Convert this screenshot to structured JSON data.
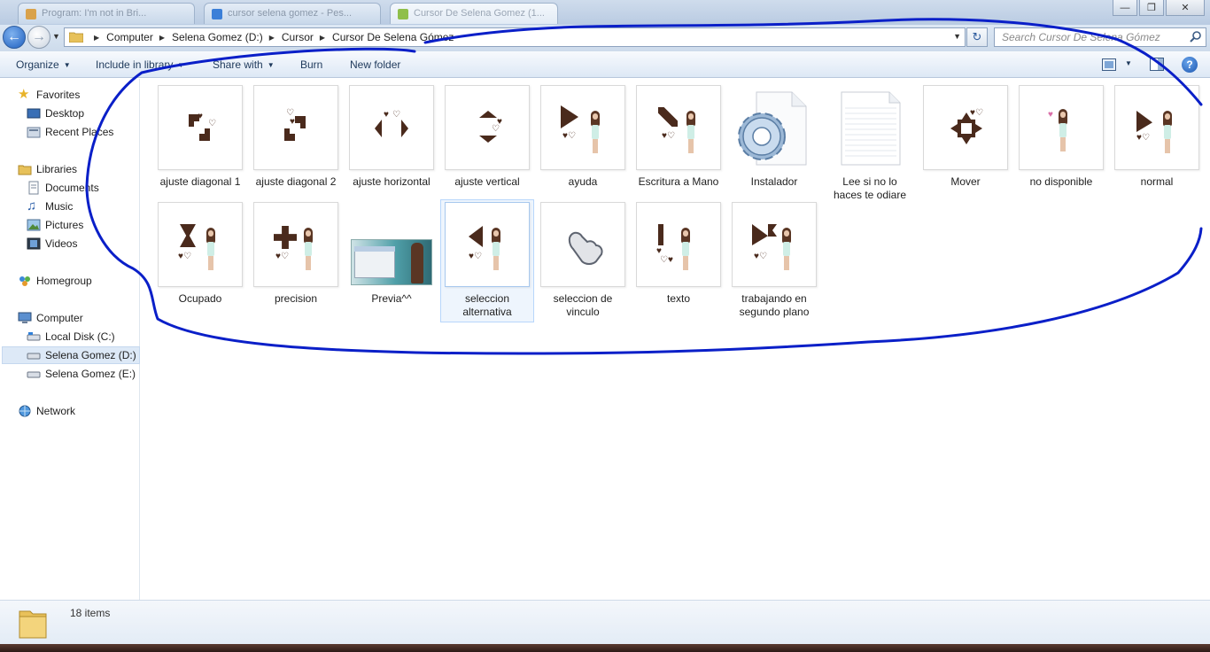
{
  "window": {
    "tabs": [
      {
        "label": "Program: I'm not in Bri..."
      },
      {
        "label": "cursor selena gomez - Pes..."
      },
      {
        "label": "Cursor De Selena Gomez (1..."
      }
    ],
    "controls": {
      "minimize": "—",
      "maximize": "❐",
      "close": "✕"
    }
  },
  "address_bar": {
    "crumbs": [
      "Computer",
      "Selena Gomez (D:)",
      "Cursor",
      "Cursor De Selena Gómez"
    ],
    "search_placeholder": "Search Cursor De Selena Gómez"
  },
  "toolbar": {
    "organize": "Organize",
    "include_in_library": "Include in library",
    "share_with": "Share with",
    "burn": "Burn",
    "new_folder": "New folder"
  },
  "nav_pane": {
    "favorites": "Favorites",
    "desktop": "Desktop",
    "recent_places": "Recent Places",
    "libraries": "Libraries",
    "documents": "Documents",
    "music": "Music",
    "pictures": "Pictures",
    "videos": "Videos",
    "homegroup": "Homegroup",
    "computer": "Computer",
    "local_disk_c": "Local Disk (C:)",
    "selena_gomez_d": "Selena Gomez (D:)",
    "selena_gomez_e": "Selena Gomez (E:)",
    "network": "Network",
    "selected": "Selena Gomez (D:)"
  },
  "files": [
    {
      "name": "ajuste diagonal 1",
      "kind": "cursor"
    },
    {
      "name": "ajuste diagonal 2",
      "kind": "cursor"
    },
    {
      "name": "ajuste horizontal",
      "kind": "cursor"
    },
    {
      "name": "ajuste vertical",
      "kind": "cursor"
    },
    {
      "name": "ayuda",
      "kind": "cursor"
    },
    {
      "name": "Escritura a Mano",
      "kind": "cursor"
    },
    {
      "name": "Instalador",
      "kind": "setup-file"
    },
    {
      "name": "Lee si no lo haces te odiare",
      "kind": "text-file"
    },
    {
      "name": "Mover",
      "kind": "cursor"
    },
    {
      "name": "no disponible",
      "kind": "cursor"
    },
    {
      "name": "normal",
      "kind": "cursor"
    },
    {
      "name": "Ocupado",
      "kind": "cursor"
    },
    {
      "name": "precision",
      "kind": "cursor"
    },
    {
      "name": "Previa^^",
      "kind": "image"
    },
    {
      "name": "seleccion alternativa",
      "kind": "cursor",
      "selected": true
    },
    {
      "name": "seleccion de vinculo",
      "kind": "cursor"
    },
    {
      "name": "texto",
      "kind": "cursor"
    },
    {
      "name": "trabajando en segundo plano",
      "kind": "cursor"
    }
  ],
  "status": {
    "item_count": "18 items"
  },
  "colors": {
    "annotation_stroke": "#0a1fc8",
    "selection": "#b8d6fb",
    "cursor_brown": "#4a2a1c"
  }
}
